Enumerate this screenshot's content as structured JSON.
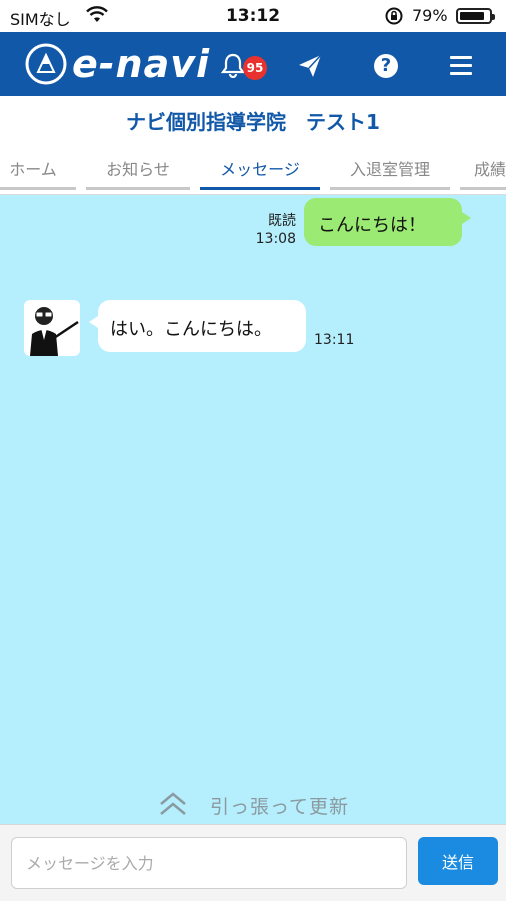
{
  "status_bar": {
    "carrier": "SIMなし",
    "time": "13:12",
    "battery": "79%"
  },
  "header": {
    "brand": "e-navi",
    "notification_count": "95",
    "help_glyph": "?",
    "icons": [
      "compass-logo-icon",
      "bell-icon",
      "paper-plane-icon",
      "help-icon",
      "menu-icon"
    ],
    "color": "#1158a8"
  },
  "school_title": "ナビ個別指導学院　テスト1",
  "tabs": [
    {
      "label": "ホーム"
    },
    {
      "label": "お知らせ"
    },
    {
      "label": "メッセージ"
    },
    {
      "label": "入退室管理"
    },
    {
      "label": "成績"
    }
  ],
  "active_tab": "メッセージ",
  "messages": {
    "sent": {
      "text": "こんにちは！",
      "read_label": "既読",
      "time": "13:08"
    },
    "received": {
      "text": "はい。こんにちは。",
      "time": "13:11"
    }
  },
  "pull_to_refresh": "引っ張って更新",
  "composer": {
    "placeholder": "メッセージを入力",
    "send_label": "送信"
  },
  "colors": {
    "chat_background": "#b5eefc",
    "sent_bubble": "#9bea73",
    "send_button": "#1a8be0"
  }
}
